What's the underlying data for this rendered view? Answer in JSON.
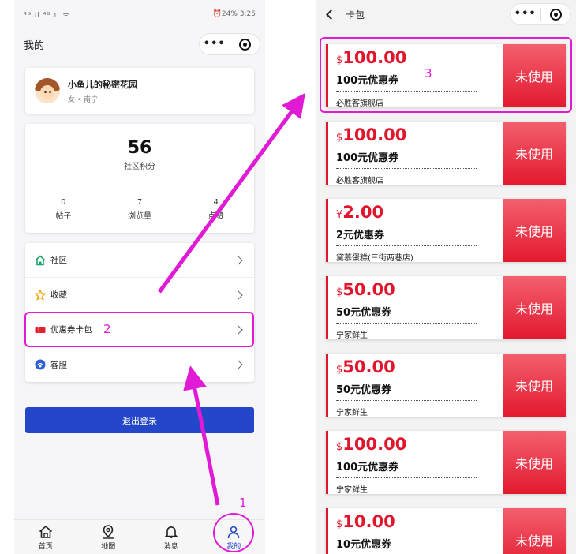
{
  "left": {
    "status": {
      "signal": "⁴ᴳ.ıl ⁴ᴳ.ıl ᯤ",
      "right": "⏰24% 3:25"
    },
    "nav_title": "我的",
    "capsule": {
      "more": "•••"
    },
    "profile": {
      "name": "小鱼儿的秘密花园",
      "sub": "女 • 南宁"
    },
    "points": {
      "value": "56",
      "label": "社区积分"
    },
    "stats": [
      {
        "value": "0",
        "label": "帖子"
      },
      {
        "value": "7",
        "label": "浏览量"
      },
      {
        "value": "4",
        "label": "点赞"
      }
    ],
    "menu": [
      {
        "label": "社区",
        "icon": "home-icon"
      },
      {
        "label": "收藏",
        "icon": "star-icon"
      },
      {
        "label": "优惠券卡包",
        "icon": "coupon-icon"
      },
      {
        "label": "客服",
        "icon": "headset-icon"
      }
    ],
    "logout": "退出登录",
    "tabs": [
      {
        "label": "首页",
        "icon": "home-icon"
      },
      {
        "label": "地图",
        "icon": "map-pin-icon"
      },
      {
        "label": "消息",
        "icon": "bell-icon"
      },
      {
        "label": "我的",
        "icon": "user-icon"
      }
    ]
  },
  "right": {
    "nav_title": "卡包",
    "coupons": [
      {
        "currency": "$",
        "amount": "100.00",
        "name": "100元优惠券",
        "store": "必胜客旗舰店",
        "status": "未使用"
      },
      {
        "currency": "$",
        "amount": "100.00",
        "name": "100元优惠券",
        "store": "必胜客旗舰店",
        "status": "未使用"
      },
      {
        "currency": "¥",
        "amount": "2.00",
        "name": "2元优惠券",
        "store": "黛慕蛋糕(三街两巷店)",
        "status": "未使用"
      },
      {
        "currency": "$",
        "amount": "50.00",
        "name": "50元优惠券",
        "store": "宁家鲜生",
        "status": "未使用"
      },
      {
        "currency": "$",
        "amount": "50.00",
        "name": "50元优惠券",
        "store": "宁家鲜生",
        "status": "未使用"
      },
      {
        "currency": "$",
        "amount": "100.00",
        "name": "100元优惠券",
        "store": "宁家鲜生",
        "status": "未使用"
      },
      {
        "currency": "$",
        "amount": "10.00",
        "name": "10元优惠券",
        "store": "",
        "status": "未使用"
      }
    ]
  },
  "annotations": {
    "step1": "1",
    "step2": "2",
    "step3": "3"
  },
  "colors": {
    "accent_blue": "#2347c8",
    "coupon_red": "#e1152b",
    "annotation_magenta": "#e11ad6"
  }
}
